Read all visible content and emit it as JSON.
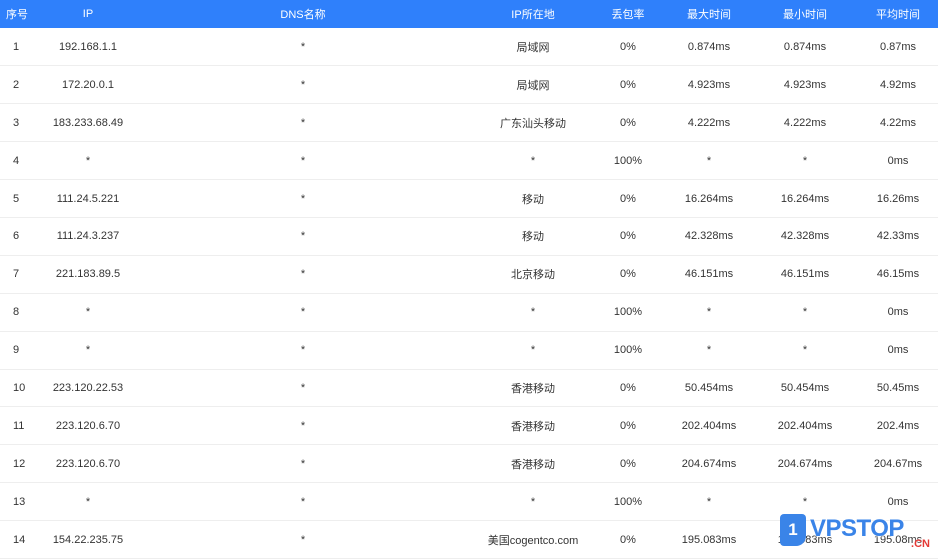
{
  "table": {
    "headers": {
      "idx": "序号",
      "ip": "IP",
      "dns": "DNS名称",
      "location": "IP所在地",
      "loss": "丢包率",
      "max": "最大时间",
      "min": "最小时间",
      "avg": "平均时间"
    },
    "rows": [
      {
        "idx": "1",
        "ip": "192.168.1.1",
        "dns": "*",
        "location": "局域网",
        "loss": "0%",
        "max": "0.874ms",
        "min": "0.874ms",
        "avg": "0.87ms"
      },
      {
        "idx": "2",
        "ip": "172.20.0.1",
        "dns": "*",
        "location": "局域网",
        "loss": "0%",
        "max": "4.923ms",
        "min": "4.923ms",
        "avg": "4.92ms"
      },
      {
        "idx": "3",
        "ip": "183.233.68.49",
        "dns": "*",
        "location": "广东汕头移动",
        "loss": "0%",
        "max": "4.222ms",
        "min": "4.222ms",
        "avg": "4.22ms"
      },
      {
        "idx": "4",
        "ip": "*",
        "dns": "*",
        "location": "*",
        "loss": "100%",
        "max": "*",
        "min": "*",
        "avg": "0ms"
      },
      {
        "idx": "5",
        "ip": "111.24.5.221",
        "dns": "*",
        "location": "移动",
        "loss": "0%",
        "max": "16.264ms",
        "min": "16.264ms",
        "avg": "16.26ms"
      },
      {
        "idx": "6",
        "ip": "111.24.3.237",
        "dns": "*",
        "location": "移动",
        "loss": "0%",
        "max": "42.328ms",
        "min": "42.328ms",
        "avg": "42.33ms"
      },
      {
        "idx": "7",
        "ip": "221.183.89.5",
        "dns": "*",
        "location": "北京移动",
        "loss": "0%",
        "max": "46.151ms",
        "min": "46.151ms",
        "avg": "46.15ms"
      },
      {
        "idx": "8",
        "ip": "*",
        "dns": "*",
        "location": "*",
        "loss": "100%",
        "max": "*",
        "min": "*",
        "avg": "0ms"
      },
      {
        "idx": "9",
        "ip": "*",
        "dns": "*",
        "location": "*",
        "loss": "100%",
        "max": "*",
        "min": "*",
        "avg": "0ms"
      },
      {
        "idx": "10",
        "ip": "223.120.22.53",
        "dns": "*",
        "location": "香港移动",
        "loss": "0%",
        "max": "50.454ms",
        "min": "50.454ms",
        "avg": "50.45ms"
      },
      {
        "idx": "11",
        "ip": "223.120.6.70",
        "dns": "*",
        "location": "香港移动",
        "loss": "0%",
        "max": "202.404ms",
        "min": "202.404ms",
        "avg": "202.4ms"
      },
      {
        "idx": "12",
        "ip": "223.120.6.70",
        "dns": "*",
        "location": "香港移动",
        "loss": "0%",
        "max": "204.674ms",
        "min": "204.674ms",
        "avg": "204.67ms"
      },
      {
        "idx": "13",
        "ip": "*",
        "dns": "*",
        "location": "*",
        "loss": "100%",
        "max": "*",
        "min": "*",
        "avg": "0ms"
      },
      {
        "idx": "14",
        "ip": "154.22.235.75",
        "dns": "*",
        "location": "美国cogentco.com",
        "loss": "0%",
        "max": "195.083ms",
        "min": "195.083ms",
        "avg": "195.08ms"
      }
    ]
  },
  "watermark": {
    "badge": "1",
    "brand": "VPSTOP",
    "suffix": ".CN"
  },
  "colors": {
    "header_bg": "#2f80fb",
    "header_text": "#ffffff",
    "row_border": "#eeeeee",
    "watermark_blue": "#3a84e8",
    "watermark_red": "#e53935"
  }
}
